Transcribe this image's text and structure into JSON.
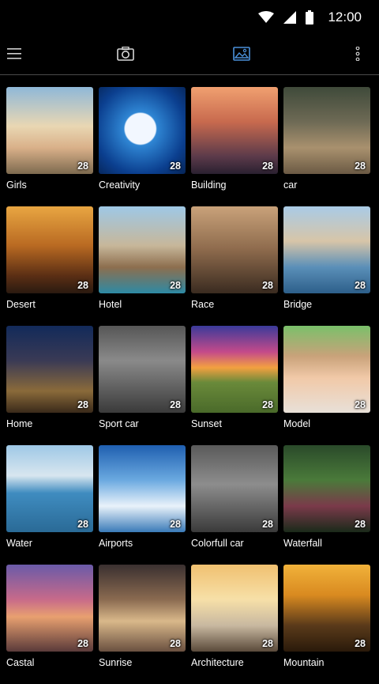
{
  "status_bar": {
    "time": "12:00"
  },
  "toolbar": {
    "menu_icon": "menu-icon",
    "camera_icon": "camera-icon",
    "gallery_icon": "image-icon",
    "more_icon": "more-vert-icon",
    "accent_color": "#4a90d9"
  },
  "categories": [
    {
      "label": "Girls",
      "count": "28"
    },
    {
      "label": "Creativity",
      "count": "28"
    },
    {
      "label": "Building",
      "count": "28"
    },
    {
      "label": "car",
      "count": "28"
    },
    {
      "label": "Desert",
      "count": "28"
    },
    {
      "label": "Hotel",
      "count": "28"
    },
    {
      "label": "Race",
      "count": "28"
    },
    {
      "label": "Bridge",
      "count": "28"
    },
    {
      "label": "Home",
      "count": "28"
    },
    {
      "label": "Sport car",
      "count": "28"
    },
    {
      "label": "Sunset",
      "count": "28"
    },
    {
      "label": "Model",
      "count": "28"
    },
    {
      "label": "Water",
      "count": "28"
    },
    {
      "label": "Airports",
      "count": "28"
    },
    {
      "label": "Colorfull car",
      "count": "28"
    },
    {
      "label": "Waterfall",
      "count": "28"
    },
    {
      "label": "Castal",
      "count": "28"
    },
    {
      "label": "Sunrise",
      "count": "28"
    },
    {
      "label": "Architecture",
      "count": "28"
    },
    {
      "label": "Mountain",
      "count": "28"
    }
  ]
}
